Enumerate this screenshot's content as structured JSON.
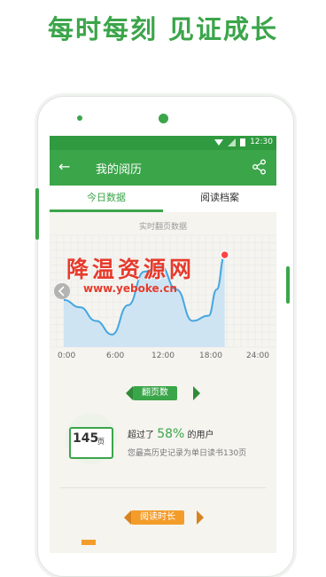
{
  "headline": "每时每刻  见证成长",
  "status": {
    "time": "12:30"
  },
  "appbar": {
    "back_icon": "←",
    "title": "我的阅历"
  },
  "tabs": [
    {
      "label": "今日数据",
      "active": true
    },
    {
      "label": "阅读档案",
      "active": false
    }
  ],
  "chart_data": {
    "type": "area",
    "title": "实时翻页数据",
    "x_ticks": [
      "0:00",
      "6:00",
      "12:00",
      "18:00",
      "24:00"
    ],
    "xlim": [
      0,
      24
    ],
    "series": [
      {
        "x": [
          0,
          2,
          4,
          6,
          8,
          10,
          12,
          14,
          16,
          18,
          19,
          20
        ],
        "y": [
          45,
          38,
          25,
          12,
          40,
          72,
          78,
          55,
          25,
          30,
          55,
          88
        ]
      }
    ],
    "ylim": [
      0,
      100
    ],
    "grid": true,
    "colors": {
      "line": "#45a6e0",
      "fill": "#cfe4f3",
      "grid": "#ececec",
      "marker": "#ff4444"
    }
  },
  "sections": {
    "pages_badge": "翻页数",
    "book_value": "145",
    "book_unit": "页",
    "beat_prefix": "超过了",
    "beat_pct": "58%",
    "beat_suffix": "的用户",
    "record_text": "您最高历史记录为单日读书130页",
    "time_badge": "阅读时长"
  },
  "watermark": {
    "text": "降温资源网",
    "url": "www.yeboke.cn"
  },
  "colors": {
    "brand": "#3ba54a",
    "status_bar": "#2f9a3f",
    "accent_orange": "#f39c2a"
  }
}
